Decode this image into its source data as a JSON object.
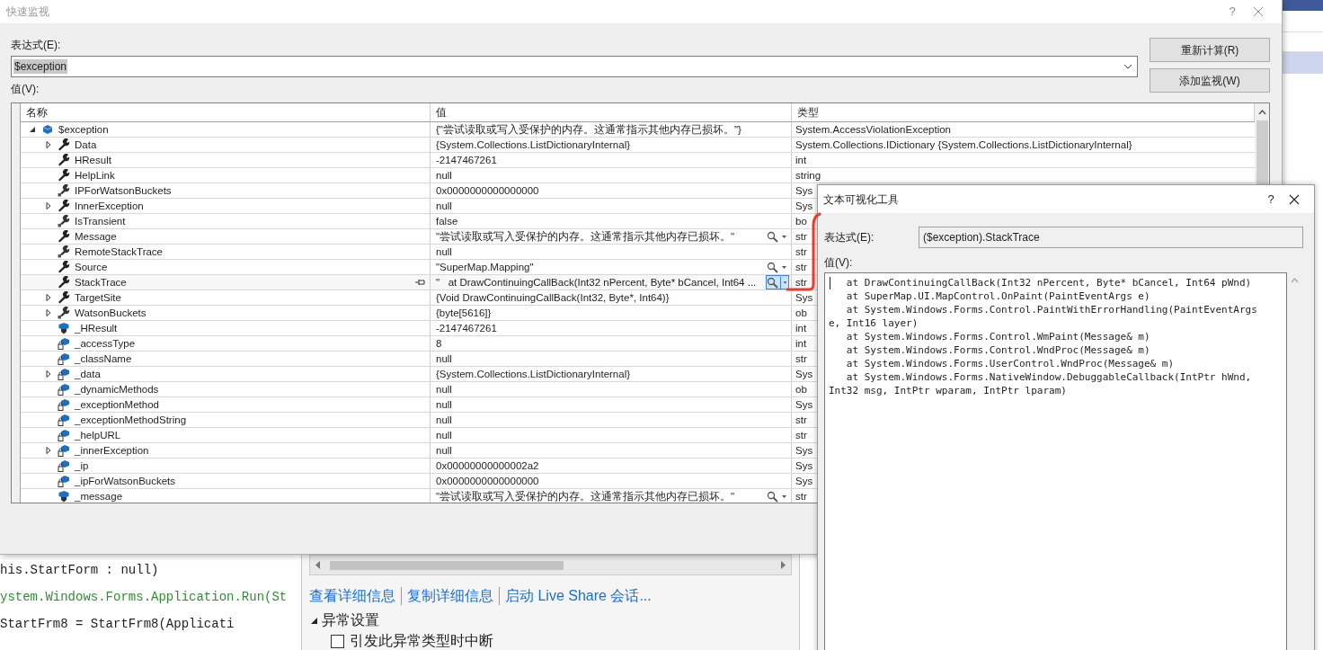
{
  "editor": {
    "lines": [
      {
        "text": "his.StartForm : null)",
        "kind": "code"
      },
      {
        "text": "ystem.Windows.Forms.Application.Run(St",
        "kind": "comment"
      },
      {
        "text": "StartFrm8 = StartFrm8(Applicati",
        "kind": "code"
      }
    ]
  },
  "exception_helper": {
    "links": [
      "查看详细信息",
      "复制详细信息",
      "启动 Live Share 会话..."
    ],
    "section": {
      "title": "异常设置",
      "expanded": true
    },
    "checkbox": {
      "label": "引发此异常类型时中断",
      "checked": false
    }
  },
  "quick_watch": {
    "title": "快速监视",
    "help_button": "?",
    "expression_label": "表达式(E):",
    "expression": "$exception",
    "buttons": [
      "重新计算(R)",
      "添加监视(W)"
    ],
    "value_label": "值(V):",
    "columns": [
      "名称",
      "值",
      "类型"
    ],
    "rows": [
      {
        "name": "$exception",
        "value": "{\"尝试读取或写入受保护的内存。这通常指示其他内存已损坏。\"}",
        "type": "System.AccessViolationException",
        "kind": "object",
        "expandable": true,
        "expanded": true,
        "visualizer": false,
        "hovered": false,
        "children": [
          {
            "name": "Data",
            "value": "{System.Collections.ListDictionaryInternal}",
            "type": "System.Collections.IDictionary {System.Collections.ListDictionaryInternal}",
            "kind": "property",
            "expandable": true,
            "expanded": false,
            "visualizer": false,
            "hovered": false
          },
          {
            "name": "HResult",
            "value": "-2147467261",
            "type": "int",
            "kind": "property",
            "expandable": false,
            "visualizer": false,
            "hovered": false
          },
          {
            "name": "HelpLink",
            "value": "null",
            "type": "string",
            "kind": "property",
            "expandable": false,
            "visualizer": false,
            "hovered": false
          },
          {
            "name": "IPForWatsonBuckets",
            "value": "0x0000000000000000",
            "type": "Sys",
            "kind": "property-private",
            "expandable": false,
            "visualizer": false,
            "hovered": false
          },
          {
            "name": "InnerException",
            "value": "null",
            "type": "Sys",
            "kind": "property",
            "expandable": true,
            "expanded": false,
            "visualizer": false,
            "hovered": false
          },
          {
            "name": "IsTransient",
            "value": "false",
            "type": "bo",
            "kind": "property-private",
            "expandable": false,
            "visualizer": false,
            "hovered": false
          },
          {
            "name": "Message",
            "value": "\"尝试读取或写入受保护的内存。这通常指示其他内存已损坏。\"",
            "type": "str",
            "kind": "property",
            "expandable": false,
            "visualizer": true,
            "visualizer_active": false,
            "hovered": false
          },
          {
            "name": "RemoteStackTrace",
            "value": "null",
            "type": "str",
            "kind": "property-private",
            "expandable": false,
            "visualizer": false,
            "hovered": false
          },
          {
            "name": "Source",
            "value": "\"SuperMap.Mapping\"",
            "type": "str",
            "kind": "property",
            "expandable": false,
            "visualizer": true,
            "visualizer_active": false,
            "hovered": false
          },
          {
            "name": "StackTrace",
            "value": "\"   at DrawContinuingCallBack(Int32 nPercent, Byte* bCancel, Int64 ...",
            "type": "str",
            "kind": "property",
            "expandable": false,
            "visualizer": true,
            "visualizer_active": true,
            "hovered": true
          },
          {
            "name": "TargetSite",
            "value": "{Void DrawContinuingCallBack(Int32, Byte*, Int64)}",
            "type": "Sys",
            "kind": "property",
            "expandable": true,
            "expanded": false,
            "visualizer": false,
            "hovered": false
          },
          {
            "name": "WatsonBuckets",
            "value": "{byte[5616]}",
            "type": "ob",
            "kind": "property-private",
            "expandable": true,
            "expanded": false,
            "visualizer": false,
            "hovered": false
          },
          {
            "name": "_HResult",
            "value": "-2147467261",
            "type": "int",
            "kind": "field-internal",
            "expandable": false,
            "visualizer": false,
            "hovered": false
          },
          {
            "name": "_accessType",
            "value": "8",
            "type": "int",
            "kind": "field-private",
            "expandable": false,
            "visualizer": false,
            "hovered": false
          },
          {
            "name": "_className",
            "value": "null",
            "type": "str",
            "kind": "field-private",
            "expandable": false,
            "visualizer": false,
            "hovered": false
          },
          {
            "name": "_data",
            "value": "{System.Collections.ListDictionaryInternal}",
            "type": "Sys",
            "kind": "field-private",
            "expandable": true,
            "expanded": false,
            "visualizer": false,
            "hovered": false
          },
          {
            "name": "_dynamicMethods",
            "value": "null",
            "type": "ob",
            "kind": "field-private",
            "expandable": false,
            "visualizer": false,
            "hovered": false
          },
          {
            "name": "_exceptionMethod",
            "value": "null",
            "type": "Sys",
            "kind": "field-private",
            "expandable": false,
            "visualizer": false,
            "hovered": false
          },
          {
            "name": "_exceptionMethodString",
            "value": "null",
            "type": "str",
            "kind": "field-private",
            "expandable": false,
            "visualizer": false,
            "hovered": false
          },
          {
            "name": "_helpURL",
            "value": "null",
            "type": "str",
            "kind": "field-private",
            "expandable": false,
            "visualizer": false,
            "hovered": false
          },
          {
            "name": "_innerException",
            "value": "null",
            "type": "Sys",
            "kind": "field-private",
            "expandable": true,
            "expanded": false,
            "visualizer": false,
            "hovered": false
          },
          {
            "name": "_ip",
            "value": "0x00000000000002a2",
            "type": "Sys",
            "kind": "field-private",
            "expandable": false,
            "visualizer": false,
            "hovered": false
          },
          {
            "name": "_ipForWatsonBuckets",
            "value": "0x0000000000000000",
            "type": "Sys",
            "kind": "field-private",
            "expandable": false,
            "visualizer": false,
            "hovered": false
          },
          {
            "name": "_message",
            "value": "\"尝试读取或写入受保护的内存。这通常指示其他内存已损坏。\"",
            "type": "str",
            "kind": "field-internal",
            "expandable": false,
            "visualizer": true,
            "visualizer_active": false,
            "hovered": false
          }
        ]
      }
    ]
  },
  "visualizer": {
    "title": "文本可视化工具",
    "help_button": "?",
    "expression_label": "表达式(E):",
    "expression": "($exception).StackTrace",
    "value_label": "值(V):",
    "lines": [
      "   at DrawContinuingCallBack(Int32 nPercent, Byte* bCancel, Int64 pWnd)",
      "   at SuperMap.UI.MapControl.OnPaint(PaintEventArgs e)",
      "   at System.Windows.Forms.Control.PaintWithErrorHandling(PaintEventArgs",
      "e, Int16 layer)",
      "   at System.Windows.Forms.Control.WmPaint(Message& m)",
      "   at System.Windows.Forms.Control.WndProc(Message& m)",
      "   at System.Windows.Forms.UserControl.WndProc(Message& m)",
      "   at System.Windows.Forms.NativeWindow.DebuggableCallback(IntPtr hWnd,",
      "Int32 msg, IntPtr wparam, IntPtr lparam)"
    ]
  }
}
